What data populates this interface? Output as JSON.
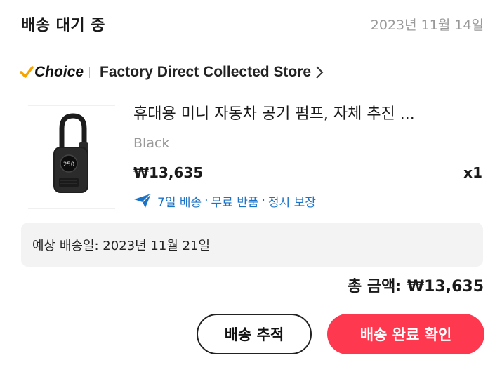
{
  "order": {
    "status": "배송 대기 중",
    "date": "2023년 11월 14일"
  },
  "store": {
    "badge_text": "Choice",
    "name": "Factory Direct Collected Store",
    "chevron": "›"
  },
  "product": {
    "title": "휴대용 미니 자동차 공기 펌프, 자체 추진 ...",
    "variant": "Black",
    "price": "₩13,635",
    "quantity": "x1",
    "display_reading": "250",
    "features": {
      "delivery": "7일 배송",
      "separator": "·",
      "returns": "무료 반품",
      "guarantee": "정시 보장"
    }
  },
  "delivery": {
    "estimate": "예상 배송일: 2023년 11월 21일"
  },
  "total": {
    "text": "총 금액: ₩13,635"
  },
  "actions": {
    "track_label": "배송 추적",
    "confirm_label": "배송 완료 확인"
  },
  "colors": {
    "accent_red": "#fd384f",
    "feature_blue": "#1a73c7",
    "choice_yellow": "#f7a400"
  },
  "icons": {
    "plane": "airplane-icon",
    "chevron": "chevron-right-icon"
  }
}
